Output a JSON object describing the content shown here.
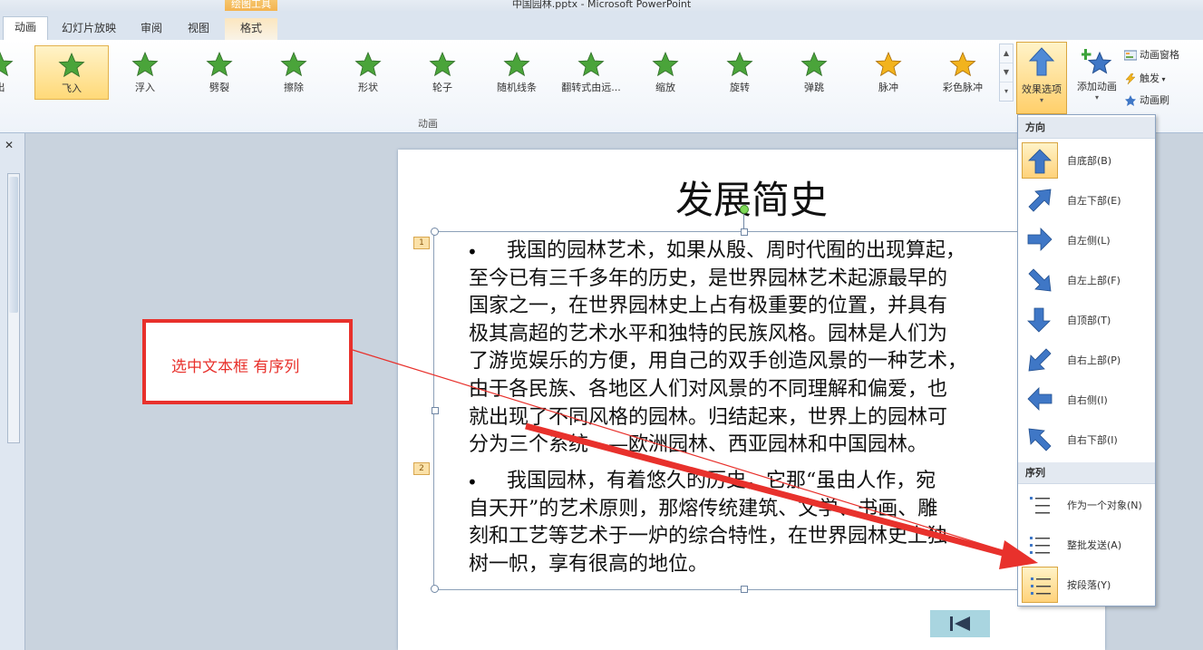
{
  "window": {
    "title": "中国园林.pptx - Microsoft PowerPoint",
    "context_tab_group": "绘图工具"
  },
  "tabs": [
    {
      "label": "动画",
      "active": true
    },
    {
      "label": "幻灯片放映"
    },
    {
      "label": "审阅"
    },
    {
      "label": "视图"
    },
    {
      "label": "格式",
      "contextual": true
    }
  ],
  "ribbon": {
    "gallery": [
      {
        "label": "出"
      },
      {
        "label": "飞入",
        "selected": true
      },
      {
        "label": "浮入"
      },
      {
        "label": "劈裂"
      },
      {
        "label": "擦除"
      },
      {
        "label": "形状"
      },
      {
        "label": "轮子"
      },
      {
        "label": "随机线条"
      },
      {
        "label": "翻转式由远..."
      },
      {
        "label": "缩放"
      },
      {
        "label": "旋转"
      },
      {
        "label": "弹跳"
      },
      {
        "label": "脉冲"
      },
      {
        "label": "彩色脉冲"
      }
    ],
    "group_label": "动画",
    "effect_options_label": "效果选项",
    "add_animation_label": "添加动画",
    "animation_pane_label": "动画窗格",
    "trigger_label": "触发",
    "animation_painter_label": "动画刷"
  },
  "slide": {
    "title": "发展简史",
    "paragraphs": [
      {
        "marker": "1",
        "bullet": "•",
        "text": "      我国的园林艺术，如果从殷、周时代囿的出现算起，\n至今已有三千多年的历史，是世界园林艺术起源最早的\n国家之一，在世界园林史上占有极重要的位置，并具有\n极其高超的艺术水平和独特的民族风格。园林是人们为\n了游览娱乐的方便，用自己的双手创造风景的一种艺术，\n由于各民族、各地区人们对风景的不同理解和偏爱，也\n就出现了不同风格的园林。归结起来，世界上的园林可\n分为三个系统——欧洲园林、西亚园林和中国园林。"
      },
      {
        "marker": "2",
        "bullet": "•",
        "text": "      我国园林，有着悠久的历史，它那“虽由人作，宛\n自天开”的艺术原则，那熔传统建筑、文学、书画、雕\n刻和工艺等艺术于一炉的综合特性，在世界园林史上独\n树一帜，享有很高的地位。"
      }
    ]
  },
  "annotation": {
    "text": "选中文本框 有序列",
    "color": "#e8312c"
  },
  "effect_options_menu": {
    "direction_header": "方向",
    "directions": [
      {
        "label": "自底部(B)",
        "icon": "arrow-up-icon",
        "selected": true
      },
      {
        "label": "自左下部(E)",
        "icon": "arrow-up-right-icon"
      },
      {
        "label": "自左侧(L)",
        "icon": "arrow-right-icon"
      },
      {
        "label": "自左上部(F)",
        "icon": "arrow-down-right-icon"
      },
      {
        "label": "自顶部(T)",
        "icon": "arrow-down-icon"
      },
      {
        "label": "自右上部(P)",
        "icon": "arrow-down-left-icon"
      },
      {
        "label": "自右侧(I)",
        "icon": "arrow-left-icon"
      },
      {
        "label": "自右下部(I)",
        "icon": "arrow-up-left-icon"
      }
    ],
    "sequence_header": "序列",
    "sequences": [
      {
        "label": "作为一个对象(N)",
        "icon": "single-object-icon"
      },
      {
        "label": "整批发送(A)",
        "icon": "all-at-once-icon"
      },
      {
        "label": "按段落(Y)",
        "icon": "by-paragraph-icon",
        "selected": true
      }
    ]
  },
  "colors": {
    "ribbon_bg": "#eef3f9",
    "selected_gold": "#ffd978",
    "star_green": "#4aa43a",
    "star_gold": "#f2b31d",
    "arrow_blue": "#3f77c6"
  }
}
